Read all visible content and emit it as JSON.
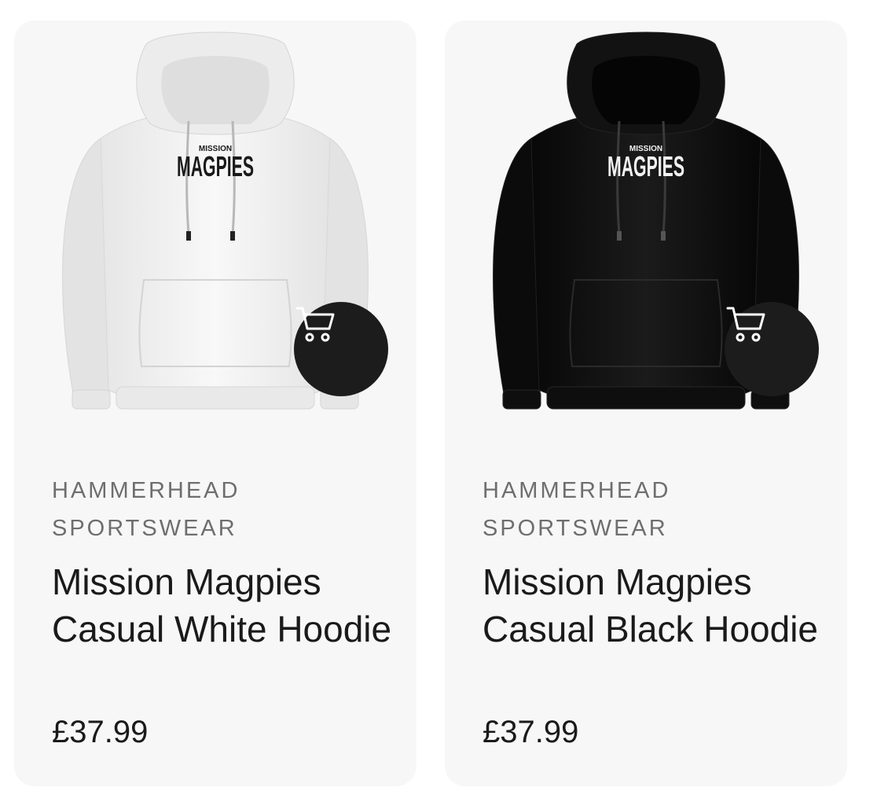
{
  "products": [
    {
      "brand_line1": "HAMMERHEAD",
      "brand_line2": "SPORTSWEAR",
      "title": "Mission Magpies Casual White Hoodie",
      "price": "£37.99",
      "image": {
        "garment_color": "#f1f1f1",
        "print_top": "MISSION",
        "print_main": "MAGPIES",
        "print_color": "#1a1a1a"
      },
      "cart_icon": "shopping-cart-icon"
    },
    {
      "brand_line1": "HAMMERHEAD",
      "brand_line2": "SPORTSWEAR",
      "title": "Mission Magpies Casual Black Hoodie",
      "price": "£37.99",
      "image": {
        "garment_color": "#111111",
        "print_top": "MISSION",
        "print_main": "MAGPIES",
        "print_color": "#f2f2f2"
      },
      "cart_icon": "shopping-cart-icon"
    }
  ]
}
